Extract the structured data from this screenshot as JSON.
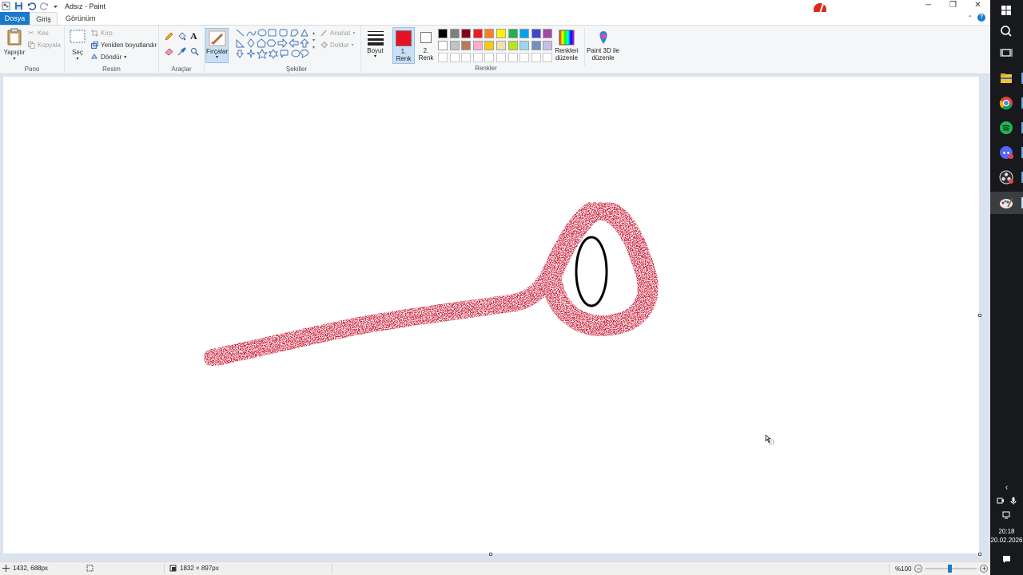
{
  "window": {
    "title": "Adsız - Paint",
    "controls": {
      "minimize": "─",
      "maximize": "❐",
      "close": "✕"
    }
  },
  "menu": {
    "tabs": [
      {
        "label": "Dosya",
        "active": false
      },
      {
        "label": "Giriş",
        "active": true
      },
      {
        "label": "Görünüm",
        "active": false
      }
    ],
    "collapse": "⌃",
    "help": "?"
  },
  "ribbon": {
    "clipboard": {
      "paste": "Yapıştır",
      "cut": "Kes",
      "copy": "Kopyala",
      "group": "Pano"
    },
    "image": {
      "select": "Seç",
      "crop": "Kırp",
      "resize": "Yeniden boyutlandır",
      "rotate": "Döndür",
      "group": "Resim"
    },
    "tools": {
      "group": "Araçlar",
      "text_icon": "A"
    },
    "brushes": {
      "label": "Fırçalar"
    },
    "shapes": {
      "outline": "Anahat",
      "fill": "Doldur",
      "group": "Şekiller"
    },
    "size": {
      "label": "Boyut"
    },
    "color1": {
      "label_line1": "1.",
      "label_line2": "Renk",
      "color": "#e81123"
    },
    "color2": {
      "label_line1": "2.",
      "label_line2": "Renk",
      "color": "#ffffff"
    },
    "palette_row1": [
      "#000000",
      "#7f7f7f",
      "#880015",
      "#ed1c24",
      "#ff7f27",
      "#fff200",
      "#22b14c",
      "#00a2e8",
      "#3f48cc",
      "#a349a4"
    ],
    "palette_row2": [
      "#ffffff",
      "#c3c3c3",
      "#b97a57",
      "#ffaec9",
      "#ffc90e",
      "#efe4b0",
      "#b5e61d",
      "#99d9ea",
      "#7092be",
      "#c8bfe7"
    ],
    "edit_colors": {
      "line1": "Renkleri",
      "line2": "düzenle"
    },
    "paint3d": {
      "line1": "Paint 3D ile",
      "line2": "düzenle"
    },
    "colors_group": "Renkler"
  },
  "status": {
    "cursor_pos": "1432, 688px",
    "canvas_size": "1832 × 897px",
    "zoom": "%100",
    "zoom_level": 1.0
  },
  "taskbar": {
    "time": "20:18",
    "date": "20.02.2026",
    "apps": [
      "windows-start",
      "search",
      "task-view",
      "file-explorer",
      "chrome",
      "spotify",
      "discord",
      "obs",
      "paint"
    ]
  },
  "colors": {
    "accent": "#1979ca",
    "brush_stroke": "#cc1a38",
    "ellipse": "#000000"
  }
}
